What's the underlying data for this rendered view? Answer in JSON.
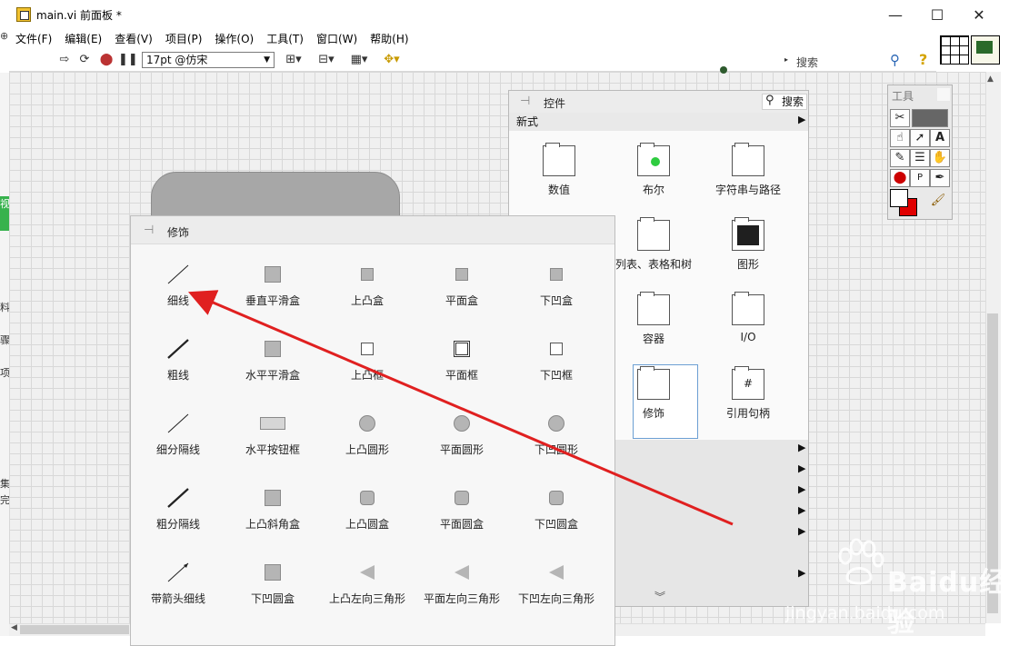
{
  "window": {
    "title": "main.vi 前面板 *",
    "minimize": "—",
    "maximize": "☐",
    "close": "✕"
  },
  "menubar": {
    "items": [
      "文件(F)",
      "编辑(E)",
      "查看(V)",
      "项目(P)",
      "操作(O)",
      "工具(T)",
      "窗口(W)",
      "帮助(H)"
    ]
  },
  "toolbar": {
    "font": "17pt @仿宋",
    "search_placeholder": "搜索",
    "icons": [
      "run-arrow",
      "run-continuously",
      "abort",
      "pause",
      "align-objects",
      "distribute-objects",
      "resize-objects",
      "reorder"
    ]
  },
  "left_edge_fragments": [
    "视",
    "料",
    "骤",
    "项",
    "集",
    "完"
  ],
  "controls_palette": {
    "title": "控件",
    "search_label": "搜索",
    "category": "新式",
    "tiles": [
      {
        "label": "数值",
        "icon": "numeric-icon"
      },
      {
        "label": "布尔",
        "icon": "boolean-icon"
      },
      {
        "label": "字符串与路径",
        "icon": "string-path-icon"
      },
      {
        "label": "列表、表格和树",
        "icon": "list-table-tree-icon"
      },
      {
        "label": "图形",
        "icon": "graph-icon"
      },
      {
        "label": "容器",
        "icon": "container-icon"
      },
      {
        "label": "I/O",
        "icon": "io-icon"
      },
      {
        "label": "修饰",
        "icon": "decorations-icon"
      },
      {
        "label": "引用句柄",
        "icon": "refnum-icon"
      }
    ],
    "more": "︾"
  },
  "tools_palette": {
    "title": "工具"
  },
  "decorations_palette": {
    "title": "修饰",
    "items": [
      "细线",
      "垂直平滑盒",
      "上凸盒",
      "平面盒",
      "下凹盒",
      "粗线",
      "水平平滑盒",
      "上凸框",
      "平面框",
      "下凹框",
      "细分隔线",
      "水平按钮框",
      "上凸圆形",
      "平面圆形",
      "下凹圆形",
      "粗分隔线",
      "上凸斜角盒",
      "上凸圆盒",
      "平面圆盒",
      "下凹圆盒",
      "带箭头细线",
      "下凹圆盒",
      "上凸左向三角形",
      "平面左向三角形",
      "下凹左向三角形"
    ]
  },
  "watermark": {
    "brand": "Baidu经验",
    "url": "jingyan.baidu.com"
  },
  "colors": {
    "arrow": "#e02020",
    "selection": "#6c9fd3",
    "watermark": "#ffffff"
  }
}
